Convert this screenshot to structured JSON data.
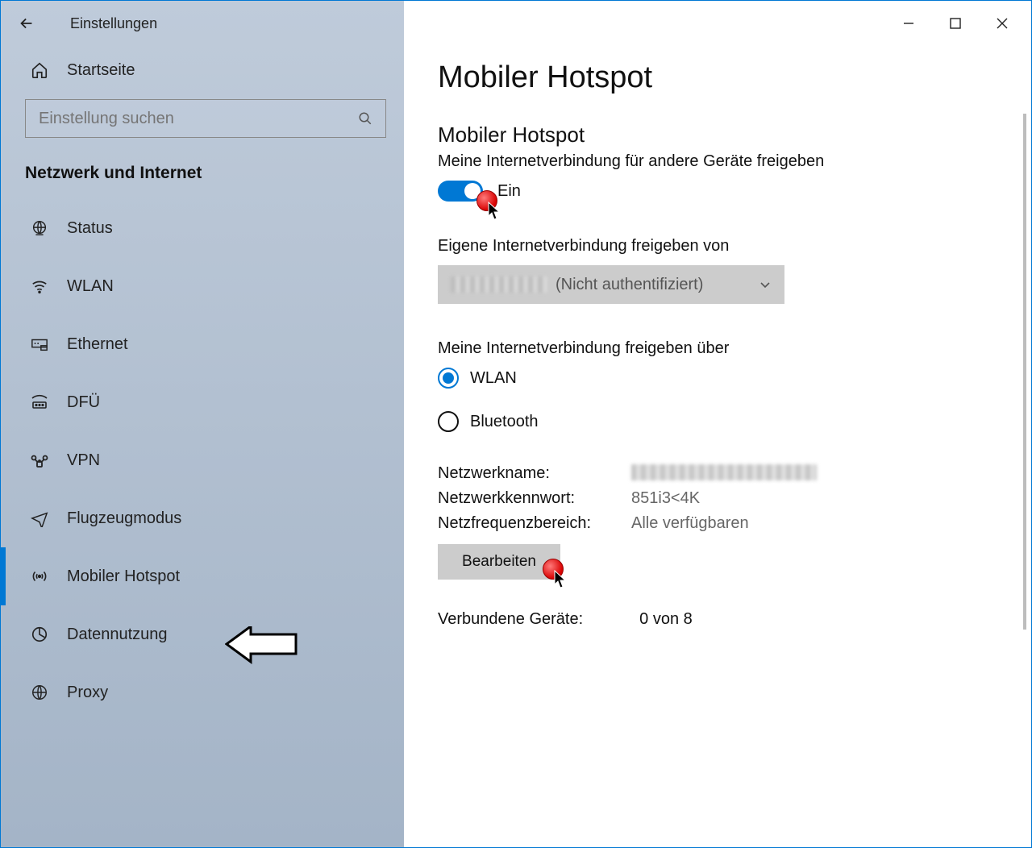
{
  "window": {
    "title": "Einstellungen"
  },
  "sidebar": {
    "home": "Startseite",
    "search_placeholder": "Einstellung suchen",
    "section": "Netzwerk und Internet",
    "items": [
      {
        "label": "Status"
      },
      {
        "label": "WLAN"
      },
      {
        "label": "Ethernet"
      },
      {
        "label": "DFÜ"
      },
      {
        "label": "VPN"
      },
      {
        "label": "Flugzeugmodus"
      },
      {
        "label": "Mobiler Hotspot"
      },
      {
        "label": "Datennutzung"
      },
      {
        "label": "Proxy"
      }
    ]
  },
  "main": {
    "page_title": "Mobiler Hotspot",
    "section_title": "Mobiler Hotspot",
    "share_desc": "Meine Internetverbindung für andere Geräte freigeben",
    "toggle_state": "Ein",
    "share_from_label": "Eigene Internetverbindung freigeben von",
    "dropdown_value_suffix": "(Nicht authentifiziert)",
    "share_via_label": "Meine Internetverbindung freigeben über",
    "radio_options": [
      "WLAN",
      "Bluetooth"
    ],
    "radio_selected": "WLAN",
    "info": {
      "name_label": "Netzwerkname:",
      "password_label": "Netzwerkkennwort:",
      "password_value": "851i3<4K",
      "band_label": "Netzfrequenzbereich:",
      "band_value": "Alle verfügbaren",
      "edit_button": "Bearbeiten",
      "connected_label": "Verbundene Geräte:",
      "connected_value": "0 von 8"
    }
  }
}
